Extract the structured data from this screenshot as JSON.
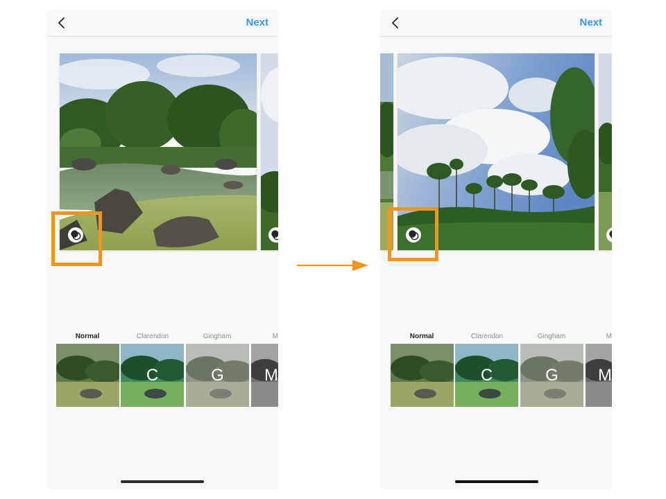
{
  "left_screen": {
    "header": {
      "next_label": "Next"
    },
    "filters": [
      {
        "label": "Normal",
        "letter": ""
      },
      {
        "label": "Clarendon",
        "letter": "C"
      },
      {
        "label": "Gingham",
        "letter": "G"
      },
      {
        "label": "M",
        "letter": "M"
      }
    ]
  },
  "right_screen": {
    "header": {
      "next_label": "Next"
    },
    "filters": [
      {
        "label": "Normal",
        "letter": ""
      },
      {
        "label": "Clarendon",
        "letter": "C"
      },
      {
        "label": "Gingham",
        "letter": "G"
      },
      {
        "label": "M",
        "letter": "M"
      }
    ]
  },
  "colors": {
    "accent_link": "#3897f0",
    "highlight": "#f7941d",
    "arrow": "#f7941d"
  },
  "icons": {
    "back": "chevron-left-icon",
    "multi_select": "multi-select-icon",
    "arrow": "right-arrow-icon"
  }
}
